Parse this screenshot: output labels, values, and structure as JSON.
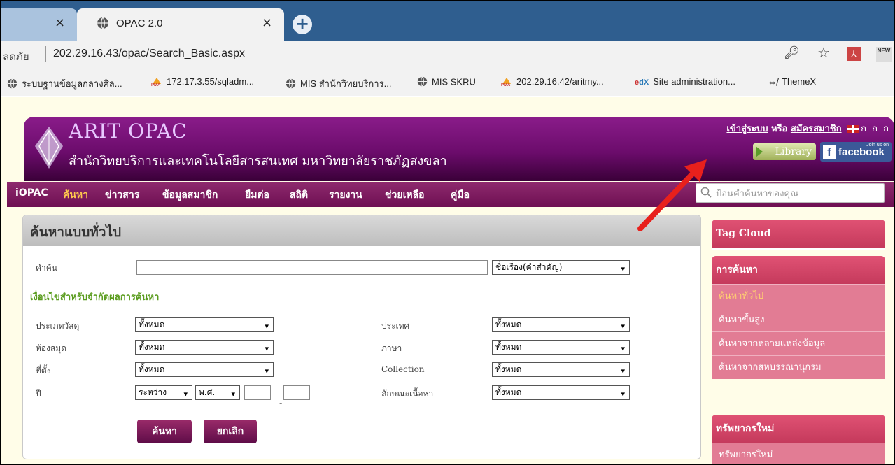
{
  "browser": {
    "tabs": [
      {
        "title": "",
        "close": "×"
      },
      {
        "title": "OPAC 2.0",
        "close": "×"
      }
    ],
    "new_tab": "+",
    "address_prefix": "ลดภัย",
    "url": "202.29.16.43/opac/Search_Basic.aspx",
    "ext_new": "NEW",
    "bookmarks": [
      {
        "label": "ระบบฐานข้อมูลกลางศิล...",
        "icon": "globe-icon"
      },
      {
        "label": "172.17.3.55/sqladm...",
        "icon": "phpmyadmin-icon"
      },
      {
        "label": "MIS สำนักวิทยบริการ...",
        "icon": "globe-icon"
      },
      {
        "label": "MIS SKRU",
        "icon": "globe-icon"
      },
      {
        "label": "202.29.16.42/aritmy...",
        "icon": "phpmyadmin-icon"
      },
      {
        "label": "Site administration...",
        "icon": "edx-icon"
      },
      {
        "label": "ThemeX",
        "icon": "themex-icon"
      }
    ]
  },
  "banner": {
    "brand": "ARIT OPAC",
    "org": "สำนักวิทยบริการและเทคโนโลยีสารสนเทศ มหาวิทยาลัยราชภัฏสงขลา",
    "login": "เข้าสู่ระบบ",
    "or": "หรือ",
    "register": "สมัครสมาชิก",
    "font_sizes": "ก ก ก",
    "library_btn": "Library",
    "facebook_btn": "facebook",
    "facebook_join": "Join us on"
  },
  "menu": {
    "items": [
      "iOPAC",
      "ค้นหา",
      "ข่าวสาร",
      "ข้อมูลสมาชิก",
      "ยืมต่อ",
      "สถิติ",
      "รายงาน",
      "ช่วยเหลือ",
      "คู่มือ"
    ],
    "active": "ค้นหา",
    "search_placeholder": "ป้อนคำค้นหาของคุณ"
  },
  "form": {
    "title": "ค้นหาแบบทั่วไป",
    "keyword_label": "คำค้น",
    "keyword_field": "ชื่อเรื่อง(คำสำคัญ)",
    "conditions_title": "เงื่อนไขสำหรับจำกัดผลการค้นหา",
    "material_label": "ประเภทวัสดุ",
    "library_label": "ห้องสมุด",
    "location_label": "ที่ตั้ง",
    "year_label": "ปี",
    "country_label": "ประเทศ",
    "language_label": "ภาษา",
    "collection_label": "Collection",
    "content_label": "ลักษณะเนื้อหา",
    "all_option": "ทั้งหมด",
    "year_mode": "ระหว่าง",
    "era": "พ.ศ.",
    "dash": "-",
    "search_btn": "ค้นหา",
    "cancel_btn": "ยกเลิก"
  },
  "sidebar": {
    "tag_cloud": "Tag Cloud",
    "search_head": "การค้นหา",
    "search_items": [
      "ค้นหาทั่วไป",
      "ค้นหาขั้นสูง",
      "ค้นหาจากหลายแหล่งข้อมูล",
      "ค้นหาจากสหบรรณานุกรม"
    ],
    "resources_head": "ทรัพยากรใหม่",
    "resources_items": [
      "ทรัพยากรใหม่"
    ]
  },
  "colors": {
    "accent": "#6e0f52",
    "arrow": "#e8201c",
    "active_menu": "#ffc94d"
  }
}
